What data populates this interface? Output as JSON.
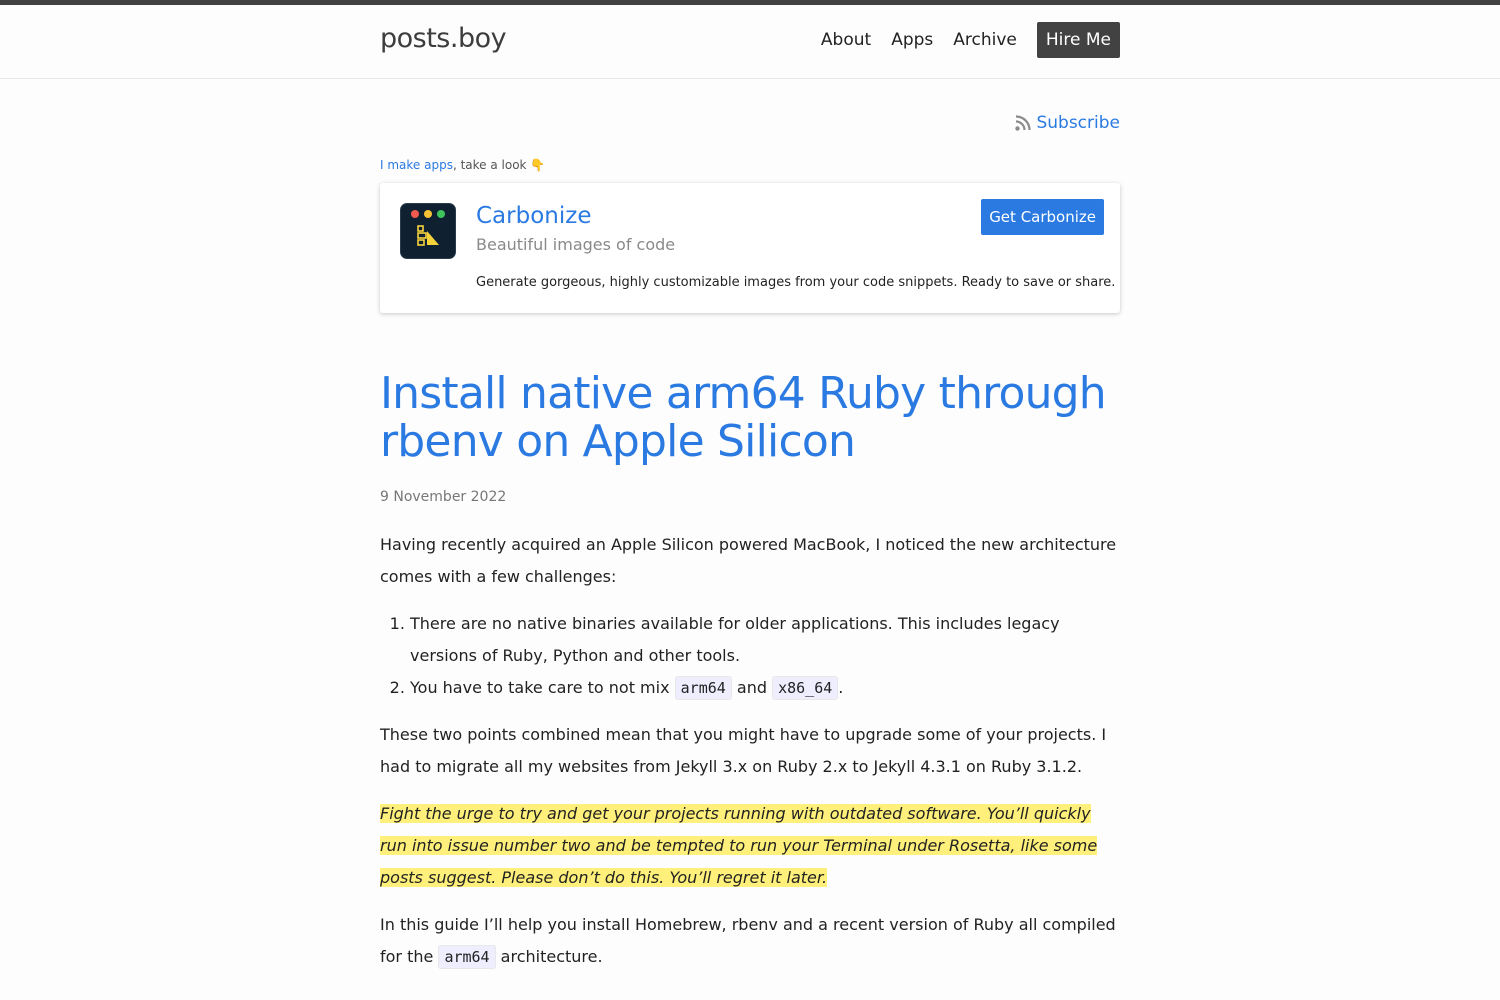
{
  "header": {
    "brand": "posts.boy",
    "nav": [
      {
        "label": "About"
      },
      {
        "label": "Apps"
      },
      {
        "label": "Archive"
      }
    ],
    "hire_label": "Hire Me"
  },
  "subscribe": {
    "label": "Subscribe",
    "icon": "rss-icon"
  },
  "promo": {
    "intro_link": "I make apps",
    "intro_rest": ", take a look 👇",
    "app_name": "Carbonize",
    "tagline": "Beautiful images of code",
    "description": "Generate gorgeous, highly customizable images from your code snippets. Ready to save or share.",
    "button_label": "Get Carbonize",
    "icon": "carbonize-app-icon"
  },
  "post": {
    "title": "Install native arm64 Ruby through rbenv on Apple Silicon",
    "date": "9 November 2022",
    "p1": "Having recently acquired an Apple Silicon powered MacBook, I noticed the new architecture comes with a few challenges:",
    "list_item_1": "There are no native binaries available for older applications. This includes legacy versions of Ruby, Python and other tools.",
    "list_item_2_before": "You have to take care to not mix ",
    "list_item_2_code1": "arm64",
    "list_item_2_mid": " and ",
    "list_item_2_code2": "x86_64",
    "list_item_2_after": ".",
    "p2": "These two points combined mean that you might have to upgrade some of your projects. I had to migrate all my websites from Jekyll 3.x on Ruby 2.x to Jekyll 4.3.1 on Ruby 3.1.2.",
    "highlight": "Fight the urge to try and get your projects running with outdated software. You’ll quickly run into issue number two and be tempted to run your Terminal under Rosetta, like some posts suggest. Please don’t do this. You’ll regret it later.",
    "p3_before": "In this guide I’ll help you install Homebrew, rbenv and a recent version of Ruby all compiled for the ",
    "p3_code": "arm64",
    "p3_after": " architecture."
  },
  "colors": {
    "accent": "#2a7ae2",
    "highlight": "#fef07a",
    "dark": "#424242"
  }
}
